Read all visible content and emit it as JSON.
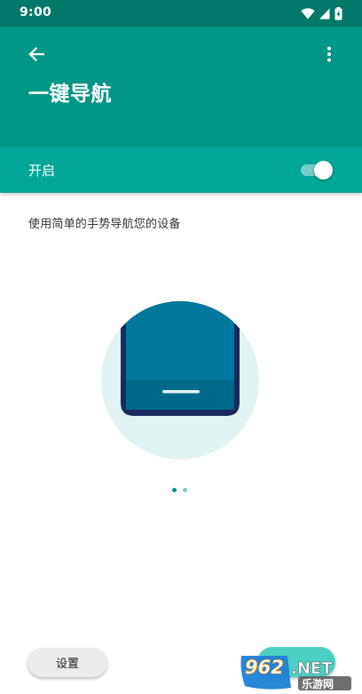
{
  "status_bar": {
    "time": "9:00",
    "icons": [
      "wifi-icon",
      "cell-signal-icon",
      "battery-icon"
    ]
  },
  "app_bar": {
    "back_icon": "arrow-back-icon",
    "more_icon": "more-vert-icon",
    "title": "一键导航"
  },
  "master_switch": {
    "label": "开启",
    "checked": true
  },
  "description": "使用简单的手势导航您的设备",
  "illustration": {
    "name": "phone-gesture-illustration"
  },
  "pager": {
    "count": 2,
    "active_index": 0
  },
  "bottom": {
    "settings_label": "设置"
  },
  "watermark": {
    "line1": "962.NET",
    "line2": "乐游网"
  },
  "colors": {
    "status_bar": "#00796b",
    "app_bar": "#009688",
    "switch_row": "#00a697",
    "phone_screen": "#00789d",
    "phone_frame": "#1a2a5e",
    "illustration_bg": "#e0f2f1",
    "dot_active": "#009688",
    "dot_inactive": "#80cbc4"
  }
}
